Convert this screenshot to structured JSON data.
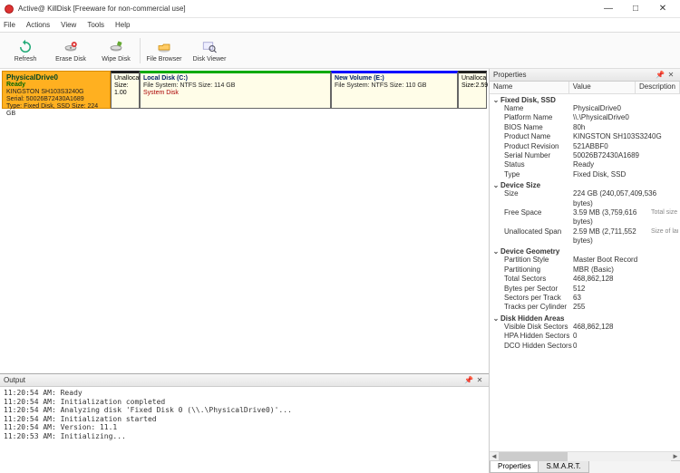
{
  "window": {
    "title": "Active@ KillDisk [Freeware for non-commercial use]"
  },
  "menu": [
    "File",
    "Actions",
    "View",
    "Tools",
    "Help"
  ],
  "toolbar": [
    {
      "label": "Refresh",
      "icon": "refresh"
    },
    {
      "label": "Erase Disk",
      "icon": "erase"
    },
    {
      "label": "Wipe Disk",
      "icon": "wipe"
    },
    {
      "label": "File Browser",
      "icon": "browser"
    },
    {
      "label": "Disk Viewer",
      "icon": "viewer"
    }
  ],
  "disk": {
    "name": "PhysicalDrive0",
    "status": "Ready",
    "model": "KINGSTON SH103S3240G",
    "serialLine": "Serial: 50026B72430A1689",
    "typeLine": "Type: Fixed Disk, SSD  Size: 224 GB"
  },
  "partitions": {
    "unallocL": {
      "title": "Unallocat",
      "sizeLine": "Size: 1.00"
    },
    "localc": {
      "title": "Local Disk (C:)",
      "fs": "File System: NTFS Size: 114 GB",
      "sys": "System Disk"
    },
    "newvol": {
      "title": "New Volume (E:)",
      "fs": "File System: NTFS Size: 110 GB"
    },
    "unallocR": {
      "title": "Unalloca",
      "sizeLine": "Size:2.59"
    }
  },
  "output": {
    "title": "Output",
    "lines": [
      "11:20:54 AM: Ready",
      "11:20:54 AM: Initialization completed",
      "11:20:54 AM: Analyzing disk 'Fixed Disk 0 (\\\\.\\PhysicalDrive0)'...",
      "11:20:54 AM: Initialization started",
      "11:20:54 AM: Version: 11.1",
      "11:20:53 AM: Initializing..."
    ]
  },
  "props": {
    "title": "Properties",
    "cols": {
      "c1": "Name",
      "c2": "Value",
      "c3": "Description"
    },
    "groups": [
      {
        "name": "Fixed Disk, SSD",
        "items": [
          {
            "k": "Name",
            "v": "PhysicalDrive0"
          },
          {
            "k": "Platform Name",
            "v": "\\\\.\\PhysicalDrive0"
          },
          {
            "k": "BIOS Name",
            "v": "80h"
          },
          {
            "k": "Product Name",
            "v": "KINGSTON SH103S3240G"
          },
          {
            "k": "Product Revision",
            "v": "521ABBF0"
          },
          {
            "k": "Serial Number",
            "v": "50026B72430A1689"
          },
          {
            "k": "Status",
            "v": "Ready"
          },
          {
            "k": "Type",
            "v": "Fixed Disk, SSD"
          }
        ]
      },
      {
        "name": "Device Size",
        "items": [
          {
            "k": "Size",
            "v": "224 GB (240,057,409,536 bytes)"
          },
          {
            "k": "Free Space",
            "v": "3.59 MB (3,759,616 bytes)",
            "d": "Total size of a"
          },
          {
            "k": "Unallocated Span",
            "v": "2.59 MB (2,711,552 bytes)",
            "d": "Size of largest"
          }
        ]
      },
      {
        "name": "Device Geometry",
        "items": [
          {
            "k": "Partition Style",
            "v": "Master Boot Record"
          },
          {
            "k": "Partitioning",
            "v": "MBR (Basic)"
          },
          {
            "k": "Total Sectors",
            "v": "468,862,128"
          },
          {
            "k": "Bytes per Sector",
            "v": "512"
          },
          {
            "k": "Sectors per Track",
            "v": "63"
          },
          {
            "k": "Tracks per Cylinder",
            "v": "255"
          }
        ]
      },
      {
        "name": "Disk Hidden Areas",
        "items": [
          {
            "k": "Visible Disk Sectors",
            "v": "468,862,128"
          },
          {
            "k": "HPA Hidden Sectors",
            "v": "0"
          },
          {
            "k": "DCO Hidden Sectors",
            "v": "0"
          }
        ]
      }
    ],
    "tabs": {
      "t1": "Properties",
      "t2": "S.M.A.R.T."
    }
  }
}
